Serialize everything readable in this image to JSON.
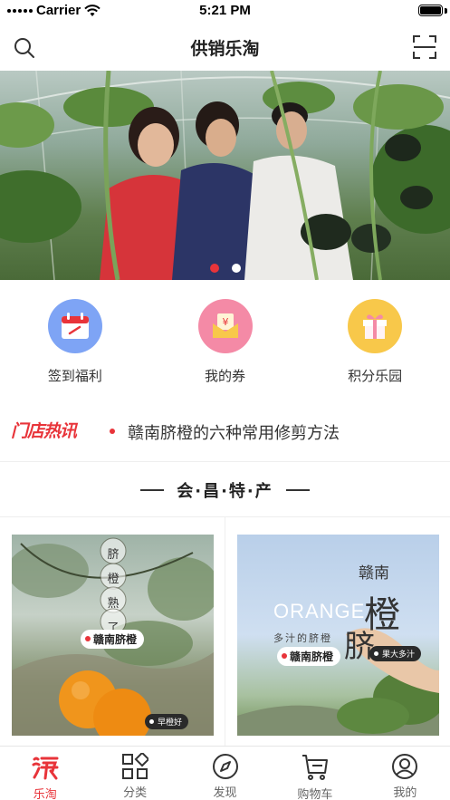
{
  "status_bar": {
    "carrier": "Carrier",
    "time": "5:21 PM"
  },
  "nav": {
    "title": "供销乐淘",
    "left_icon": "search-icon",
    "right_icon": "scan-icon"
  },
  "banner": {
    "slide_count": 2,
    "active_slide": 1,
    "active_dot_color": "#e8343a",
    "inactive_dot_color": "#ffffff"
  },
  "quick_actions": [
    {
      "label": "签到福利",
      "icon": "calendar-icon",
      "color": "#7ea4f5"
    },
    {
      "label": "我的券",
      "icon": "coupon-icon",
      "color": "#f48aa6"
    },
    {
      "label": "积分乐园",
      "icon": "gift-icon",
      "color": "#f8c84a"
    }
  ],
  "news": {
    "logo_text": "门店热讯",
    "headline": "赣南脐橙的六种常用修剪方法"
  },
  "section": {
    "title": "会·昌·特·产"
  },
  "products": [
    {
      "tag": "赣南脐橙",
      "badge": "早橙好",
      "overlay_chars": [
        "脐",
        "橙",
        "熟",
        "了"
      ]
    },
    {
      "tag": "赣南脐橙",
      "badge": "果大多汁",
      "overlay_title": "赣南",
      "overlay_en": "ORANGE",
      "overlay_big": "橙",
      "overlay_big2": "脐",
      "overlay_sub": "多汁的脐橙"
    }
  ],
  "tabs": [
    {
      "label": "乐淘",
      "icon": "taobao-icon",
      "active": true
    },
    {
      "label": "分类",
      "icon": "category-icon",
      "active": false
    },
    {
      "label": "发现",
      "icon": "compass-icon",
      "active": false
    },
    {
      "label": "购物车",
      "icon": "cart-icon",
      "active": false
    },
    {
      "label": "我的",
      "icon": "user-icon",
      "active": false
    }
  ],
  "colors": {
    "accent": "#e8343a",
    "text": "#333333"
  }
}
